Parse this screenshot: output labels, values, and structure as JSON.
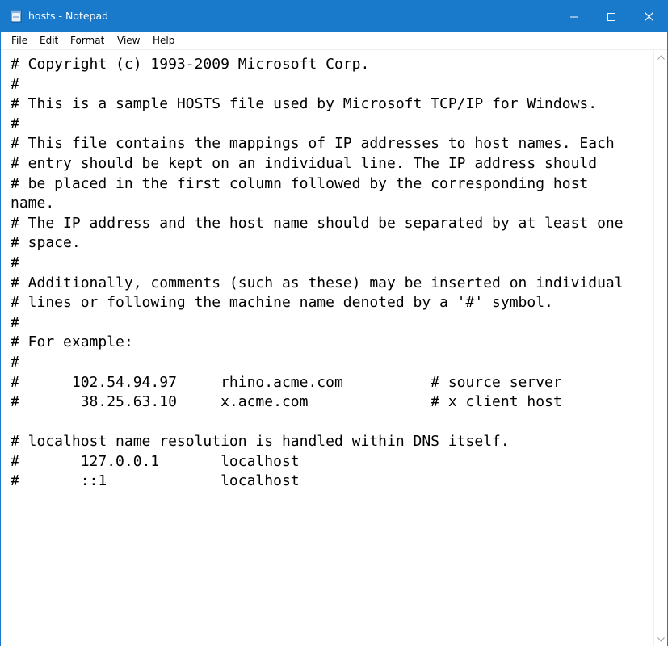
{
  "window": {
    "title": "hosts - Notepad",
    "accent_color": "#1979ca",
    "icons": {
      "app": "notepad-icon",
      "minimize": "minimize-icon",
      "maximize": "maximize-icon",
      "close": "close-icon"
    }
  },
  "menu": {
    "items": [
      "File",
      "Edit",
      "Format",
      "View",
      "Help"
    ]
  },
  "editor": {
    "lines": [
      "# Copyright (c) 1993-2009 Microsoft Corp.",
      "#",
      "# This is a sample HOSTS file used by Microsoft TCP/IP for Windows.",
      "#",
      "# This file contains the mappings of IP addresses to host names. Each",
      "# entry should be kept on an individual line. The IP address should",
      "# be placed in the first column followed by the corresponding host",
      "name.",
      "# The IP address and the host name should be separated by at least one",
      "# space.",
      "#",
      "# Additionally, comments (such as these) may be inserted on individual",
      "# lines or following the machine name denoted by a '#' symbol.",
      "#",
      "# For example:",
      "#",
      "#      102.54.94.97     rhino.acme.com          # source server",
      "#       38.25.63.10     x.acme.com              # x client host",
      "",
      "# localhost name resolution is handled within DNS itself.",
      "#       127.0.0.1       localhost",
      "#       ::1             localhost"
    ]
  },
  "scrollbar": {
    "up_icon": "scroll-up-arrow-icon",
    "down_icon": "scroll-down-arrow-icon"
  }
}
